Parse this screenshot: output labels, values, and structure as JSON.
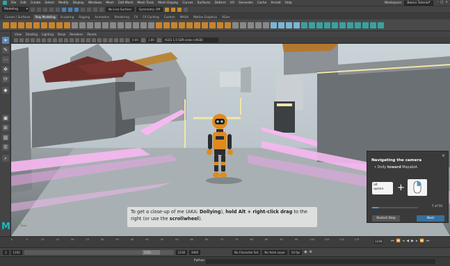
{
  "menubar": {
    "items": [
      "File",
      "Edit",
      "Create",
      "Select",
      "Modify",
      "Display",
      "Windows",
      "Mesh",
      "Edit Mesh",
      "Mesh Tools",
      "Mesh Display",
      "Curves",
      "Surfaces",
      "Deform",
      "UV",
      "Generate",
      "Cache",
      "Arnold",
      "Help"
    ],
    "workspace_label": "Workspace:",
    "workspace_value": "Basics Tutorial*"
  },
  "statusline": {
    "mode": "Modeling",
    "live_surface": "No Live Surface",
    "symmetry": "Symmetry: Off"
  },
  "shelf_tabs": {
    "tabs": [
      "Curves / Surfaces",
      "Poly Modeling",
      "Sculpting",
      "Rigging",
      "Animation",
      "Rendering",
      "FX",
      "FX Caching",
      "Custom",
      "MASH",
      "Motion Graphics",
      "XGen"
    ],
    "active": "Poly Modeling"
  },
  "panel_menu": {
    "items": [
      "View",
      "Shading",
      "Lighting",
      "Show",
      "Renderer",
      "Panels"
    ]
  },
  "panel_toolbar": {
    "value_a": "0.00",
    "value_b": "1.00",
    "color_space": "ACES 1.0 SDR-video (sRGB)"
  },
  "subtitle": {
    "part1": "To get a close-up of me (AKA: ",
    "bold1": "Dollying",
    "part2": "), ",
    "bold2": "hold Alt + right-click drag",
    "part3": " to the right (or use the ",
    "bold3": "scrollwheel",
    "part4": ")."
  },
  "tutorial": {
    "title": "Navigating the camera",
    "step_prefix": "Dolly ",
    "step_bold": "toward",
    "step_suffix": " Mayabot.",
    "key_line1": "alt",
    "key_line2": "option",
    "progress_text": "7 of 50",
    "progress_fraction": 0.14,
    "restart_label": "Restart Step",
    "next_label": "Next"
  },
  "timeslider": {
    "tick_labels": [
      "0",
      "5",
      "10",
      "15",
      "20",
      "25",
      "30",
      "35",
      "40",
      "45",
      "50",
      "55",
      "60",
      "65",
      "70",
      "75",
      "80",
      "85",
      "90",
      "95",
      "100",
      "105",
      "110",
      "115"
    ],
    "current_frame": "1218"
  },
  "range": {
    "start": "1",
    "playback_start": "1102",
    "inner_label": "1102",
    "end_a": "1218",
    "end_b": "3000",
    "character_set": "No Character Set",
    "anim_layer": "No Anim Layer",
    "fps": "24 fps"
  },
  "cmdline": {
    "language": "Python"
  },
  "colors": {
    "accent": "#4a9bd6",
    "maya_teal": "#1fb6c1",
    "neon": "#f6a6f0",
    "robot_orange": "#e08a1e"
  }
}
